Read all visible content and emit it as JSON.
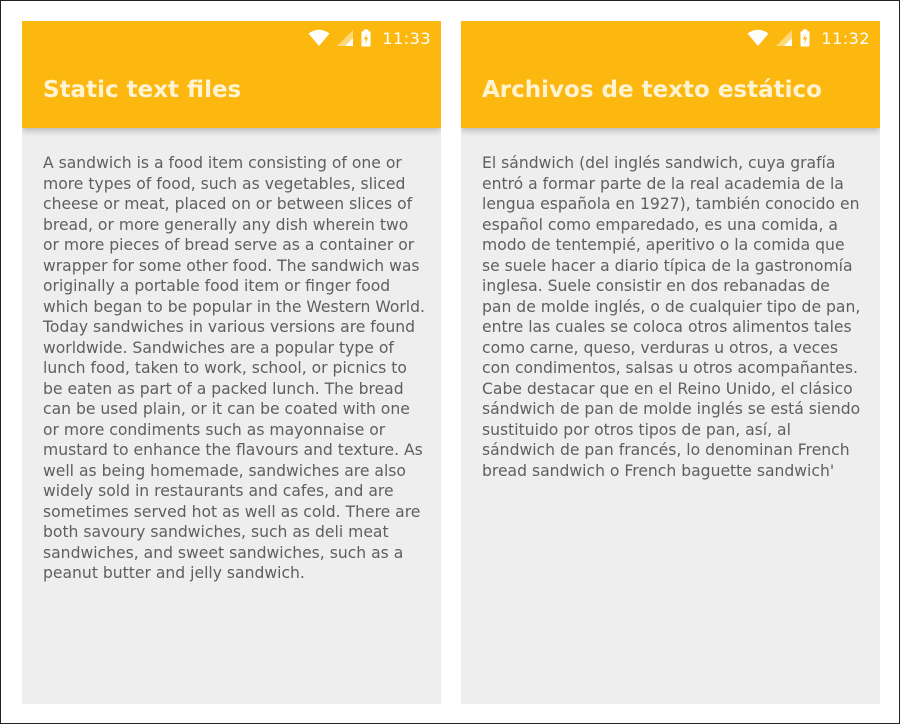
{
  "screens": {
    "left": {
      "status": {
        "time": "11:33",
        "wifi_icon": "wifi-icon",
        "signal_icon": "cell-signal-icon",
        "battery_icon": "battery-charging-icon"
      },
      "title": "Static text files",
      "body": "A sandwich is a food item consisting of one or more types of food, such as vegetables, sliced cheese or meat, placed on or between slices of bread, or more generally any dish wherein two or more pieces of bread serve as a container or wrapper for some other food. The sandwich was originally a portable food item or finger food which began to be popular in the Western World. Today sandwiches in various versions are found worldwide. Sandwiches are a popular type of lunch food, taken to work, school, or picnics to be eaten as part of a packed lunch. The bread can be used plain, or it can be coated with one or more condiments such as mayonnaise or mustard to enhance the flavours and texture. As well as being homemade, sandwiches are also widely sold in restaurants and cafes, and are sometimes served hot as well as cold. There are both savoury sandwiches, such as deli meat sandwiches, and sweet sandwiches, such as a peanut butter and jelly sandwich."
    },
    "right": {
      "status": {
        "time": "11:32",
        "wifi_icon": "wifi-icon",
        "signal_icon": "cell-signal-icon",
        "battery_icon": "battery-charging-icon"
      },
      "title": "Archivos de texto estático",
      "body": "El sándwich (del inglés sandwich, cuya grafía entró a formar parte de la real academia de la lengua española en 1927), también conocido en español como emparedado, es una comida, a modo de tentempié, aperitivo o la comida que se suele hacer a diario típica de la gastronomía inglesa. Suele consistir en dos rebanadas de pan de molde inglés, o de cualquier tipo de pan, entre las cuales se coloca otros alimentos tales como carne, queso, verduras u otros, a veces con condimentos, salsas u otros acompañantes. Cabe destacar que en el Reino Unido, el clásico sándwich de pan de molde inglés se está siendo sustituido por otros tipos de pan, así, al sándwich de pan francés, lo denominan French bread sandwich o French baguette sandwich'"
    }
  },
  "colors": {
    "app_bar": "#fdb810",
    "title_text": "#fff3d2",
    "background": "#eeeeee",
    "body_text": "#5f5f5f"
  }
}
